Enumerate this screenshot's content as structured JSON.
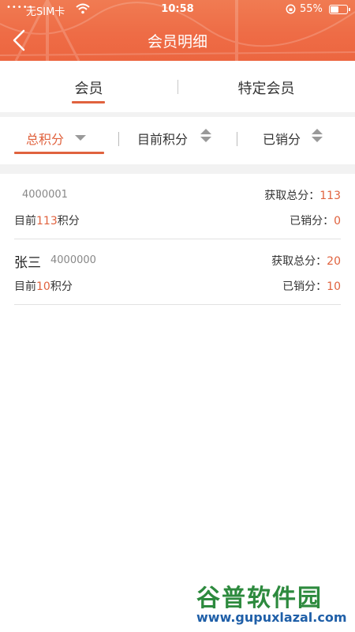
{
  "status_bar": {
    "signal": "•••••",
    "carrier": "无SIM卡",
    "time": "10:58",
    "battery": "55%",
    "battery_level": 0.55
  },
  "nav": {
    "title": "会员明细",
    "back_icon": "chevron-left-icon"
  },
  "tabs": [
    {
      "label": "会员",
      "active": true
    },
    {
      "label": "特定会员",
      "active": false
    }
  ],
  "sort": [
    {
      "label": "总积分",
      "active": true,
      "icon": "triangle-down-icon"
    },
    {
      "label": "目前积分",
      "active": false,
      "icon": "sort-updown-icon"
    },
    {
      "label": "已销分",
      "active": false,
      "icon": "sort-updown-icon"
    }
  ],
  "members": [
    {
      "name": "",
      "id": "4000001",
      "earned_label": "获取总分：",
      "earned_value": "113",
      "current_prefix": "目前",
      "current_value": "113",
      "current_suffix": "积分",
      "sold_label": "已销分：",
      "sold_value": "0"
    },
    {
      "name": "张三",
      "id": "4000000",
      "earned_label": "获取总分：",
      "earned_value": "20",
      "current_prefix": "目前",
      "current_value": "10",
      "current_suffix": "积分",
      "sold_label": "已销分：",
      "sold_value": "10"
    }
  ],
  "watermark": {
    "title": "谷普软件园",
    "url": "www.gupuxlazal.com"
  },
  "colors": {
    "header": "#ee6b45",
    "accent": "#e0623e"
  }
}
